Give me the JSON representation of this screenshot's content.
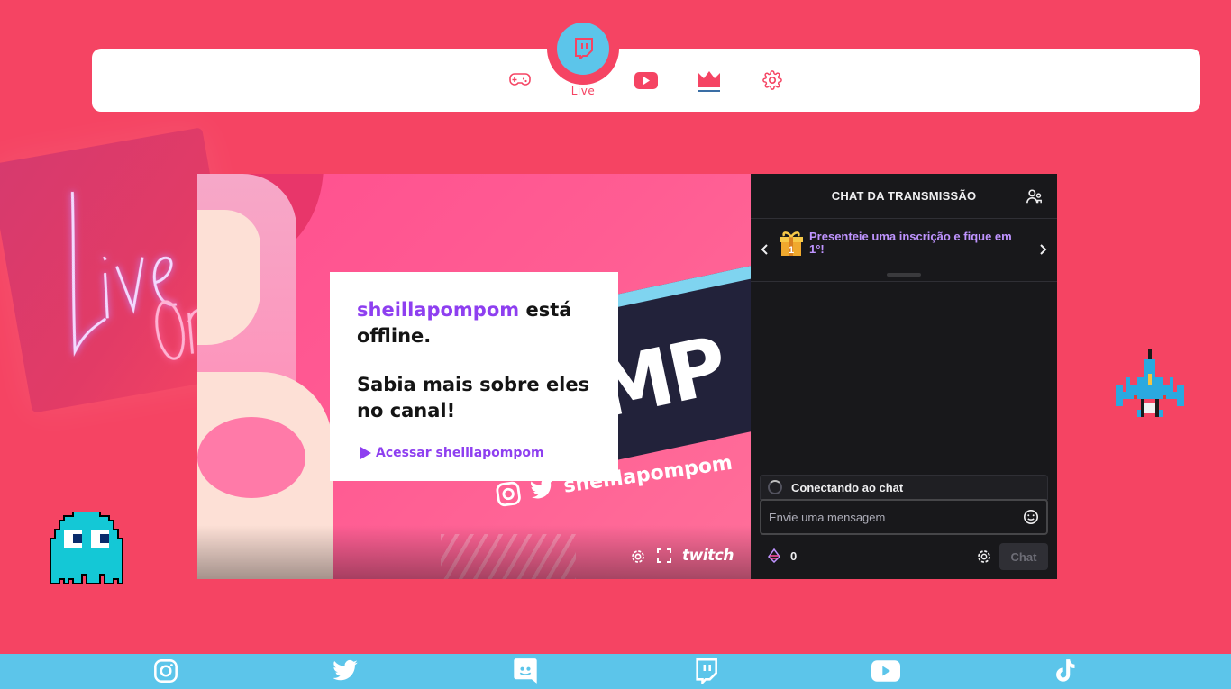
{
  "nav": {
    "items": [
      {
        "icon": "gamepad-icon"
      },
      {
        "icon": "twitch-icon",
        "label": "Live",
        "active": true
      },
      {
        "icon": "youtube-icon"
      },
      {
        "icon": "crown-icon"
      },
      {
        "icon": "gear-icon"
      }
    ],
    "active_label": "Live"
  },
  "player": {
    "banner_handle": "sheillapompom",
    "banner_letters": "MP",
    "offline_channel": "sheillapompom",
    "offline_suffix": " está offline.",
    "offline_subtitle": "Sabia mais sobre eles no canal!",
    "offline_link": "Acessar sheillapompom",
    "brand": "twitch"
  },
  "chat": {
    "header": "CHAT DA TRANSMISSÃO",
    "promo": "Presenteie uma inscrição e fique em 1°!",
    "gift_number": "1",
    "connecting": "Conectando ao chat",
    "input_placeholder": "Envie uma mensagem",
    "bits_count": "0",
    "chat_button": "Chat"
  },
  "decor": {
    "neon_text": "Live",
    "neon_text2": "On"
  },
  "footer": {
    "icons": [
      "instagram-icon",
      "twitter-icon",
      "discord-icon",
      "twitch-icon",
      "youtube-icon",
      "tiktok-icon"
    ]
  },
  "colors": {
    "background": "#f54463",
    "accent_blue": "#5cc5ea",
    "twitch_purple": "#8e3ff0",
    "chat_bg": "#18181b"
  }
}
